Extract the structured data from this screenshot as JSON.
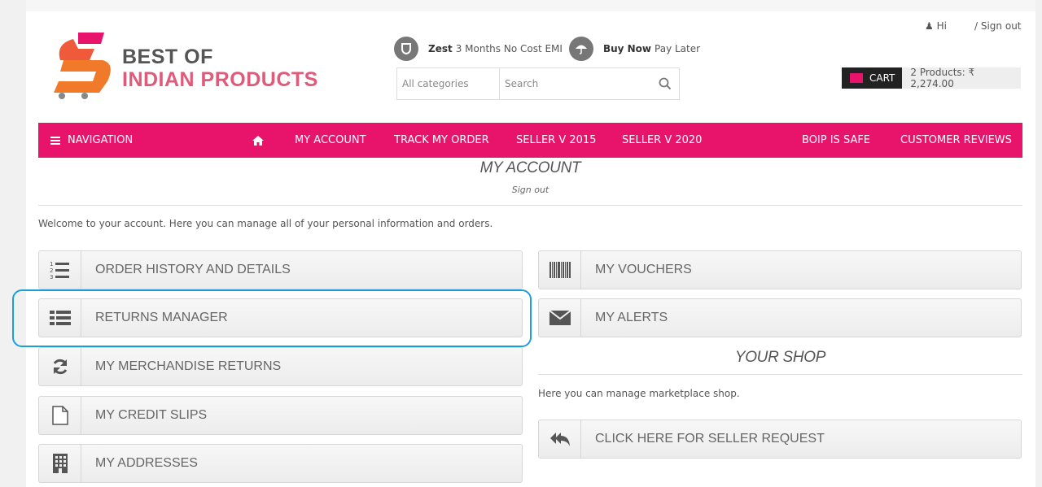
{
  "header": {
    "logo": {
      "line1": "BEST OF",
      "line2": "INDIAN PRODUCTS"
    },
    "emi": [
      {
        "icon": "shield-icon",
        "brand": "Zest",
        "text": "3 Months No Cost EMI"
      },
      {
        "icon": "umbrella-icon",
        "brand": "Buy Now",
        "text": "Pay Later"
      }
    ],
    "search": {
      "category": "All categories",
      "placeholder": "Search"
    },
    "user": {
      "greeting": "Hi",
      "signout": "/ Sign out"
    },
    "cart": {
      "label": "CART",
      "summary": "2 Products: ₹ 2,274.00"
    }
  },
  "nav": {
    "navigation": "NAVIGATION",
    "items": [
      "MY ACCOUNT",
      "TRACK MY ORDER",
      "SELLER V 2015",
      "SELLER V 2020",
      "BOIP IS SAFE",
      "CUSTOMER REVIEWS"
    ]
  },
  "account": {
    "title": "MY ACCOUNT",
    "signout": "Sign out",
    "welcome": "Welcome to your account. Here you can manage all of your personal information and orders.",
    "left_buttons": [
      {
        "icon": "ordered-list-icon",
        "label": "ORDER HISTORY AND DETAILS"
      },
      {
        "icon": "list-icon",
        "label": "RETURNS MANAGER"
      },
      {
        "icon": "refresh-icon",
        "label": "MY MERCHANDISE RETURNS"
      },
      {
        "icon": "file-icon",
        "label": "MY CREDIT SLIPS"
      },
      {
        "icon": "building-icon",
        "label": "MY ADDRESSES"
      }
    ],
    "right_buttons": [
      {
        "icon": "barcode-icon",
        "label": "MY VOUCHERS"
      },
      {
        "icon": "envelope-icon",
        "label": "MY ALERTS"
      }
    ]
  },
  "shop": {
    "title": "YOUR SHOP",
    "text": "Here you can manage marketplace shop.",
    "button": {
      "icon": "reply-all-icon",
      "label": "CLICK HERE FOR SELLER REQUEST"
    }
  },
  "colors": {
    "brand": "#e8146c",
    "highlight": "#1a9fd9"
  }
}
